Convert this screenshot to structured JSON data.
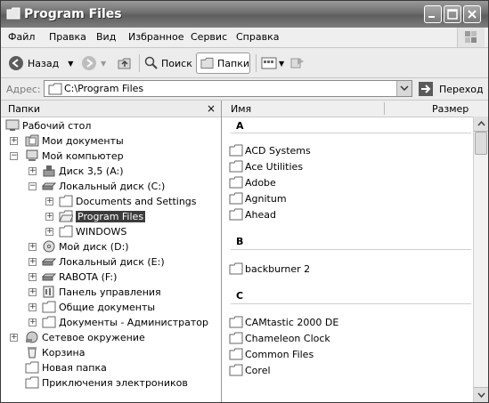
{
  "window": {
    "title": "Program Files"
  },
  "menu": [
    {
      "label": "Файл"
    },
    {
      "label": "Правка"
    },
    {
      "label": "Вид"
    },
    {
      "label": "Избранное"
    },
    {
      "label": "Сервис"
    },
    {
      "label": "Справка"
    }
  ],
  "toolbar": {
    "back": "Назад",
    "search": "Поиск",
    "folders": "Папки"
  },
  "address": {
    "label": "Адрес:",
    "value": "C:\\Program Files",
    "go": "Переход"
  },
  "folder_pane": {
    "title": "Папки",
    "tree": [
      {
        "label": "Рабочий стол",
        "icon": "desktop-icon"
      },
      {
        "label": "Мои документы",
        "icon": "my-documents-icon"
      },
      {
        "label": "Мой компьютер",
        "icon": "my-computer-icon"
      },
      {
        "label": "Диск 3,5 (A:)",
        "icon": "floppy-drive-icon"
      },
      {
        "label": "Локальный диск (C:)",
        "icon": "hard-drive-icon"
      },
      {
        "label": "Documents and Settings",
        "icon": "folder-icon"
      },
      {
        "label": "Program Files",
        "icon": "folder-open-icon"
      },
      {
        "label": "WINDOWS",
        "icon": "folder-icon"
      },
      {
        "label": "Мой диск (D:)",
        "icon": "cd-drive-icon"
      },
      {
        "label": "Локальный диск (E:)",
        "icon": "hard-drive-icon"
      },
      {
        "label": "RABOTA (F:)",
        "icon": "hard-drive-icon"
      },
      {
        "label": "Панель управления",
        "icon": "control-panel-icon"
      },
      {
        "label": "Общие документы",
        "icon": "folder-icon"
      },
      {
        "label": "Документы - Администратор",
        "icon": "folder-icon"
      },
      {
        "label": "Сетевое окружение",
        "icon": "network-icon"
      },
      {
        "label": "Корзина",
        "icon": "recycle-bin-icon"
      },
      {
        "label": "Новая папка",
        "icon": "folder-icon"
      },
      {
        "label": "Приключения электроников",
        "icon": "folder-icon"
      }
    ]
  },
  "list": {
    "columns": {
      "name": "Имя",
      "size": "Размер"
    },
    "groups": [
      {
        "letter": "A",
        "items": [
          "ACD Systems",
          "Ace Utilities",
          "Adobe",
          "Agnitum",
          "Ahead"
        ]
      },
      {
        "letter": "B",
        "items": [
          "backburner 2"
        ]
      },
      {
        "letter": "C",
        "items": [
          "CAMtastic 2000 DE",
          "Chameleon Clock",
          "Common Files",
          "Corel"
        ]
      }
    ]
  }
}
